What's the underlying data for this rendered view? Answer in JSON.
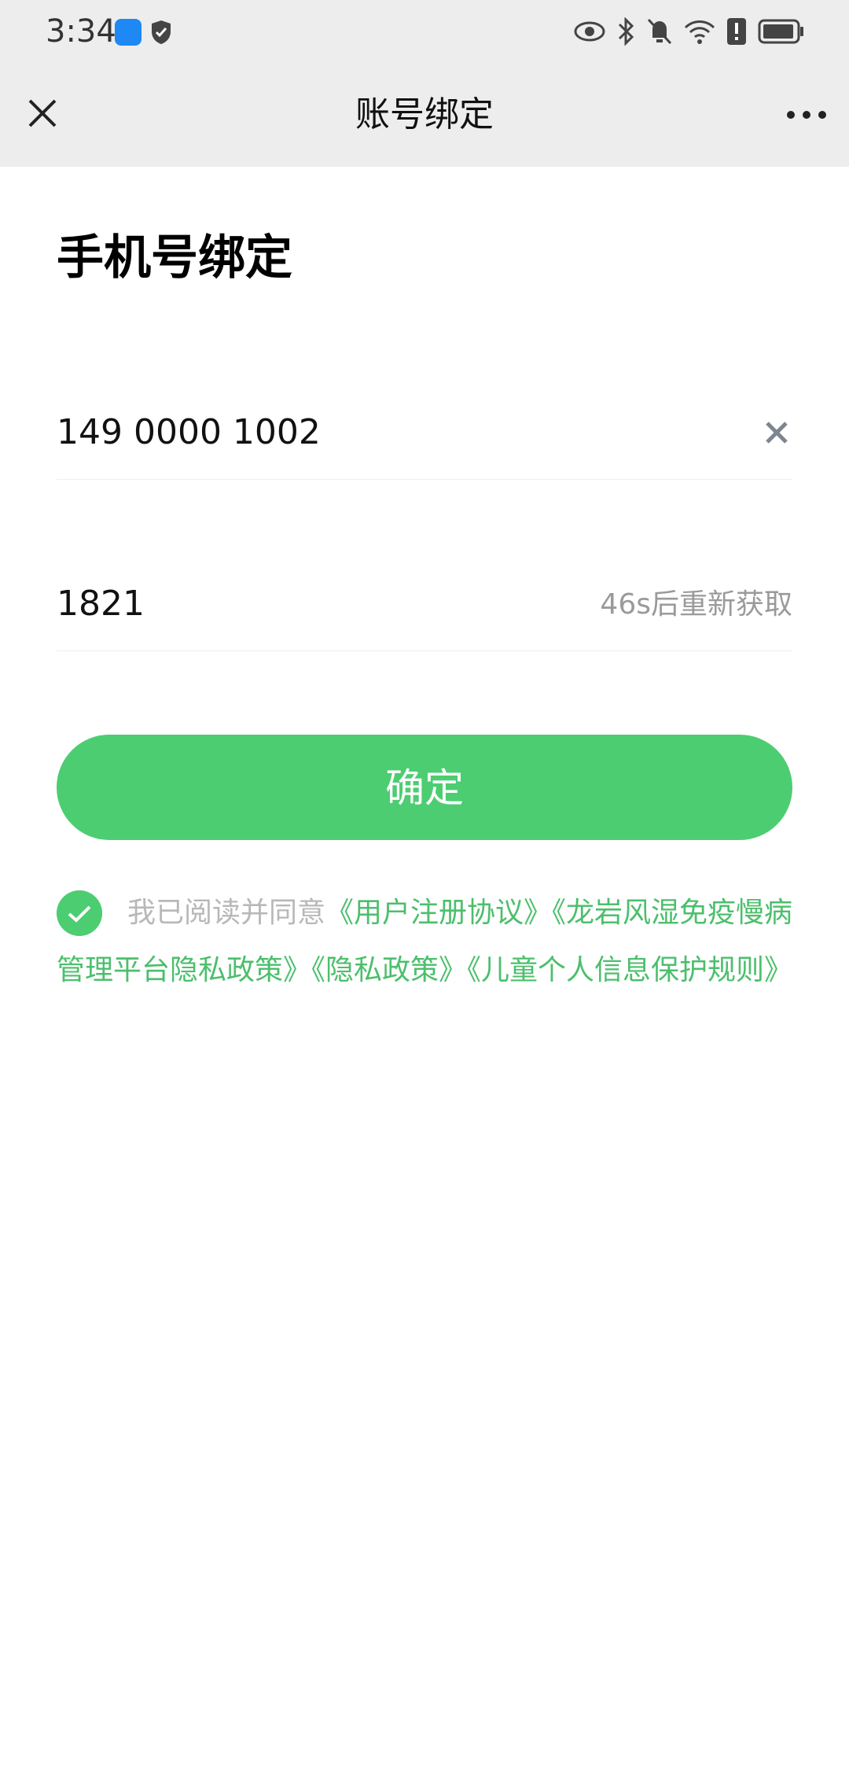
{
  "status_bar": {
    "time": "3:34",
    "icons": [
      "weather-app-icon",
      "shield-icon",
      "eye-icon",
      "bluetooth-icon",
      "bell-off-icon",
      "wifi-icon",
      "alert-icon",
      "battery-icon"
    ]
  },
  "nav": {
    "title": "账号绑定",
    "close_icon": "close-icon",
    "more_icon": "more-icon"
  },
  "page": {
    "heading": "手机号绑定"
  },
  "form": {
    "phone_value": "149 0000 1002",
    "code_value": "1821",
    "resend_label": "46s后重新获取",
    "confirm_label": "确定"
  },
  "agreement": {
    "prefix": "我已阅读并同意",
    "links": [
      "《用户注册协议》",
      "《龙岩风湿免疫慢病管理平台隐私政策》",
      "《隐私政策》",
      "《儿童个人信息保护规则》"
    ],
    "checked": true
  },
  "colors": {
    "accent": "#4ccd72",
    "link": "#4cbf6c",
    "nav_bg": "#ededed"
  }
}
